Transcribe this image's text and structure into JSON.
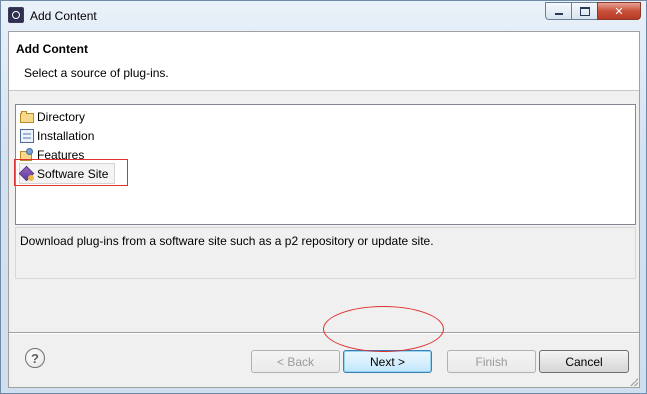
{
  "window": {
    "title": "Add Content",
    "controls": {
      "minimize": "",
      "maximize": "",
      "close": "✕"
    }
  },
  "header": {
    "title": "Add Content",
    "description": "Select a source of plug-ins."
  },
  "sources": {
    "items": [
      {
        "label": "Directory",
        "icon": "folder-icon"
      },
      {
        "label": "Installation",
        "icon": "installation-icon"
      },
      {
        "label": "Features",
        "icon": "features-icon"
      },
      {
        "label": "Software Site",
        "icon": "software-site-icon",
        "selected": true
      }
    ]
  },
  "description": {
    "text": "Download plug-ins from a software site such as a p2 repository or update site."
  },
  "buttons": {
    "help": "?",
    "back": "< Back",
    "next": "Next >",
    "finish": "Finish",
    "cancel": "Cancel"
  },
  "colors": {
    "annotation": "#e03030",
    "default_button_border": "#3c7fb1"
  }
}
